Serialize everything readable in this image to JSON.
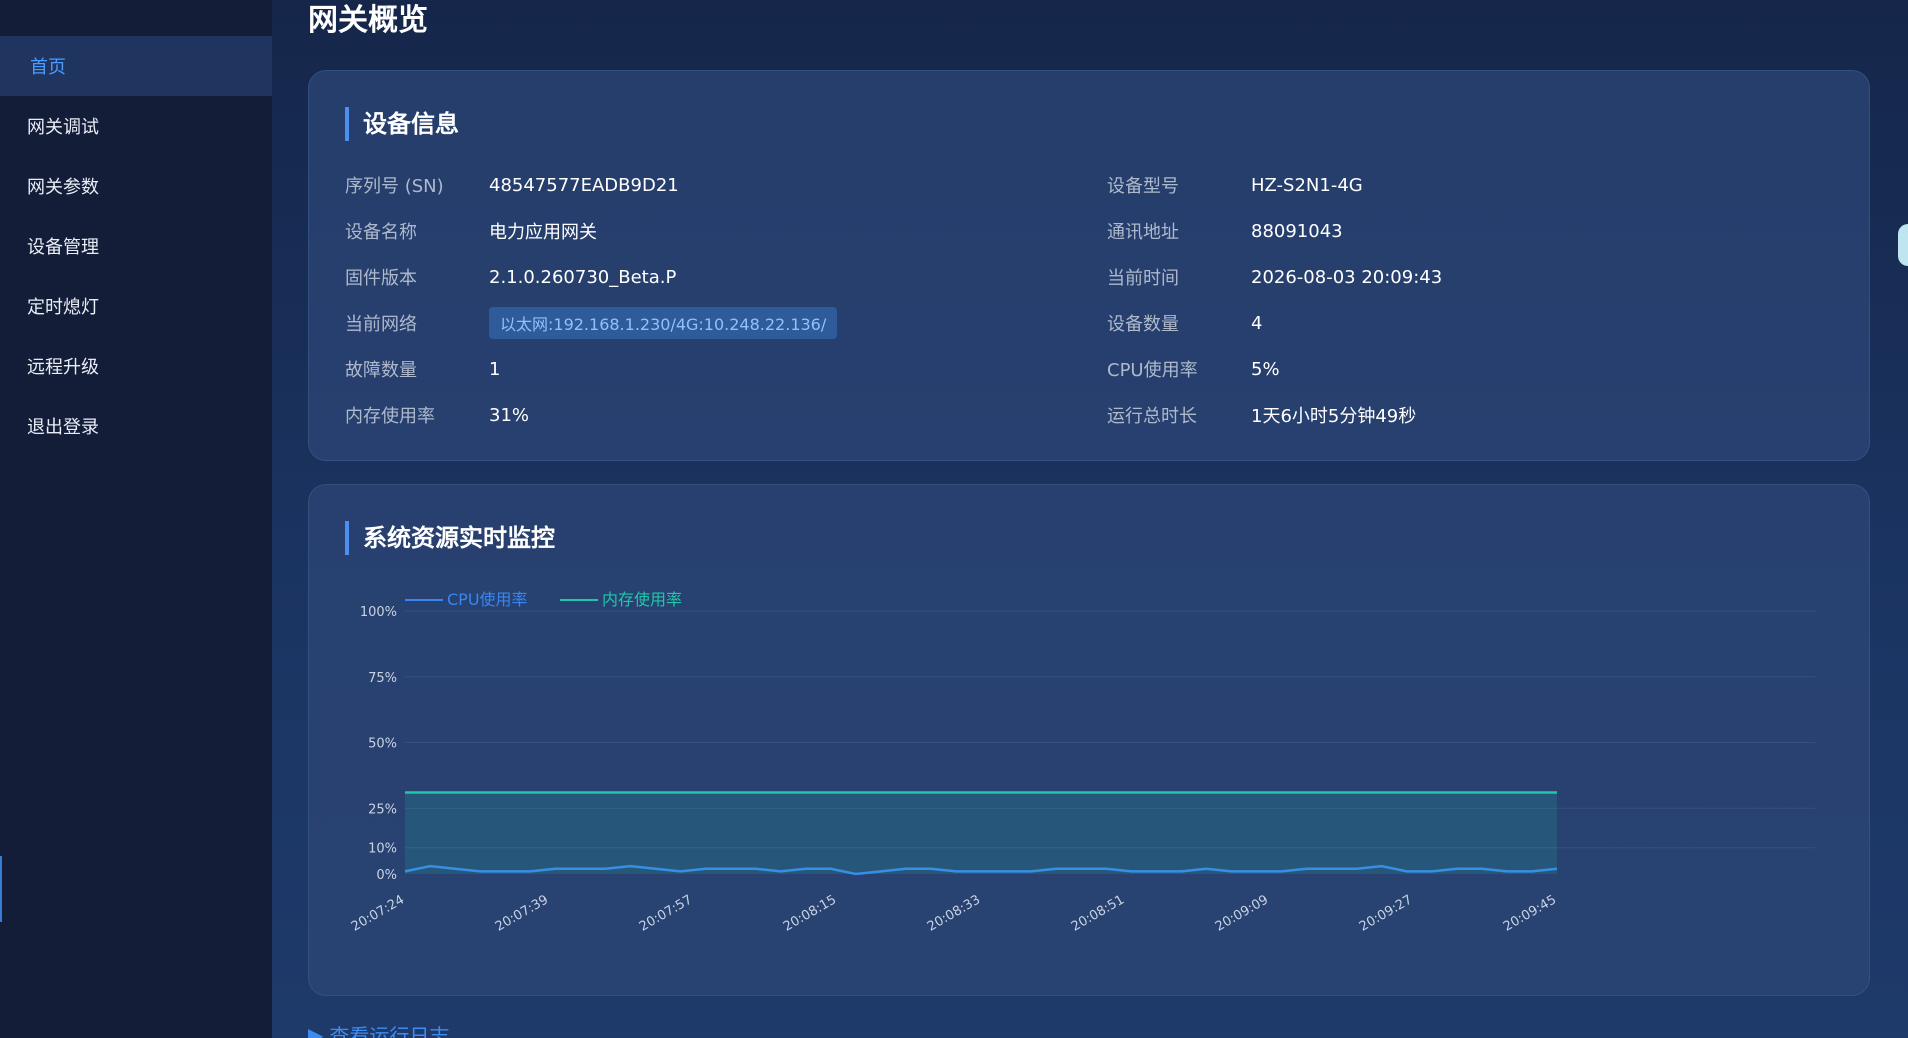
{
  "sidebar": {
    "items": [
      {
        "label": "首页",
        "active": true
      },
      {
        "label": "网关调试"
      },
      {
        "label": "网关参数"
      },
      {
        "label": "设备管理"
      },
      {
        "label": "定时熄灯"
      },
      {
        "label": "远程升级"
      },
      {
        "label": "退出登录"
      }
    ]
  },
  "page": {
    "title": "网关概览"
  },
  "device_info": {
    "title": "设备信息",
    "left": [
      {
        "label": "序列号 (SN)",
        "value": "48547577EADB9D21"
      },
      {
        "label": "设备名称",
        "value": "电力应用网关"
      },
      {
        "label": "固件版本",
        "value": "2.1.0.260730_Beta.P"
      },
      {
        "label": "当前网络",
        "value": "以太网:192.168.1.230/4G:10.248.22.136/"
      },
      {
        "label": "故障数量",
        "value": "1"
      },
      {
        "label": "内存使用率",
        "value": "31%"
      }
    ],
    "right": [
      {
        "label": "设备型号",
        "value": "HZ-S2N1-4G"
      },
      {
        "label": "通讯地址",
        "value": "88091043"
      },
      {
        "label": "当前时间",
        "value": "2026-08-03 20:09:43"
      },
      {
        "label": "设备数量",
        "value": "4"
      },
      {
        "label": "CPU使用率",
        "value": "5%"
      },
      {
        "label": "运行总时长",
        "value": "1天6小时5分钟49秒"
      }
    ]
  },
  "monitor": {
    "title": "系统资源实时监控"
  },
  "log_link": {
    "label": "查看运行日志"
  },
  "colors": {
    "accent": "#4d9bff",
    "cpu": "#3a86f0",
    "mem": "#22c6a8"
  },
  "chart_data": {
    "type": "line",
    "title": "",
    "xlabel": "",
    "ylabel": "",
    "ylim": [
      0,
      100
    ],
    "y_ticks": [
      "0%",
      "10%",
      "25%",
      "50%",
      "75%",
      "100%"
    ],
    "y_tick_values": [
      0,
      10,
      25,
      50,
      75,
      100
    ],
    "x_tick_labels": [
      "20:07:24",
      "20:07:39",
      "20:07:57",
      "20:08:15",
      "20:08:33",
      "20:08:51",
      "20:09:09",
      "20:09:27",
      "20:09:45"
    ],
    "grid": true,
    "legend": "top-left",
    "series": [
      {
        "name": "CPU使用率",
        "color": "#3a86f0",
        "values": [
          1,
          3,
          2,
          1,
          1,
          1,
          2,
          2,
          2,
          3,
          2,
          1,
          2,
          2,
          2,
          1,
          2,
          2,
          0,
          1,
          2,
          2,
          1,
          1,
          1,
          1,
          2,
          2,
          2,
          1,
          1,
          1,
          2,
          1,
          1,
          1,
          2,
          2,
          2,
          3,
          1,
          1,
          2,
          2,
          1,
          1,
          2
        ]
      },
      {
        "name": "内存使用率",
        "color": "#22c6a8",
        "area": true,
        "values": [
          31,
          31,
          31,
          31,
          31,
          31,
          31,
          31,
          31,
          31,
          31,
          31,
          31,
          31,
          31,
          31,
          31,
          31,
          31,
          31,
          31,
          31,
          31,
          31,
          31,
          31,
          31,
          31,
          31,
          31,
          31,
          31,
          31,
          31,
          31,
          31,
          31,
          31,
          31,
          31,
          31,
          31,
          31,
          31,
          31,
          31,
          31
        ]
      }
    ]
  }
}
